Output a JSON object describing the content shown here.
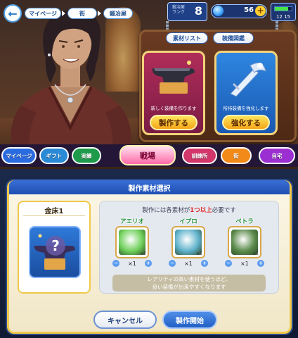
{
  "header": {
    "back_icon": "back-arrow-icon",
    "breadcrumbs": [
      "マイページ",
      "街",
      "鍛冶屋"
    ],
    "rank_label_line1": "鍛冶屋",
    "rank_label_line2": "ランク",
    "rank_value": "8",
    "gems": "56",
    "stamina_text": "12 15",
    "stamina_fraction": 0.8
  },
  "blacksmith": {
    "tabs": [
      "素材リスト",
      "装備図鑑"
    ],
    "craft_card": {
      "desc": "新しく装備を作ります",
      "button": "製作する",
      "icon": "anvil-icon"
    },
    "enhance_card": {
      "desc": "所持装備を強化します",
      "button": "強化する",
      "icon": "sword-icon"
    }
  },
  "nav": {
    "items": [
      "マイページ",
      "ギフト",
      "実績",
      "戦場",
      "訓練所",
      "街",
      "自宅"
    ],
    "colors": [
      "#2b6be0",
      "#2b8ad6",
      "#1d9a4a",
      "#ff6aa9",
      "#d2366b",
      "#f28a1a",
      "#9b2fd1"
    ]
  },
  "dialog": {
    "title": "製作素材選択",
    "slot_name": "金床1",
    "slot_icon": "mystery-anvil-icon",
    "requirement_prefix": "製作には各素材が",
    "requirement_highlight": "1つ以上",
    "requirement_suffix": "必要です",
    "materials": [
      {
        "name": "アエリオ",
        "count": "×2",
        "qty": "×1",
        "color": "#6fd05a"
      },
      {
        "name": "イプロ",
        "count": "×1",
        "qty": "×1",
        "color": "#5fb2cc"
      },
      {
        "name": "ペトラ",
        "count": "×1",
        "qty": "×1",
        "color": "#5a8a4a"
      }
    ],
    "note_line1": "レアリティの高い素材を使うほど、",
    "note_line2": "良い装備が出来やすくなります",
    "cancel_button": "キャンセル",
    "start_button": "製作開始"
  }
}
